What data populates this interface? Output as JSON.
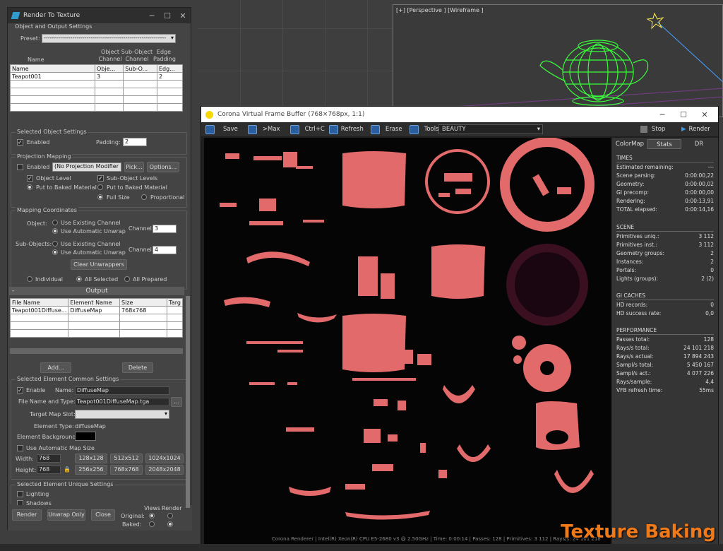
{
  "viewport": {
    "label": "[+] [Perspective ] [Wireframe ]"
  },
  "rtt": {
    "title": "Render To Texture",
    "section_object_output": "Object and Output Settings",
    "preset_label": "Preset:",
    "preset_value": "------------------------------------------------------------",
    "obj_headers_top": [
      "Name",
      "Object Channel",
      "Sub-Object Channel",
      "Edge Padding"
    ],
    "obj_cols": [
      "Name",
      "Obje...",
      "Sub-O...",
      "Edg..."
    ],
    "obj_rows": [
      [
        "Teapot001",
        "3",
        "",
        "2"
      ]
    ],
    "section_selected": "Selected Object Settings",
    "enabled_label": "Enabled",
    "padding_label": "Padding:",
    "padding_value": "2",
    "section_projection": "Projection Mapping",
    "proj_enabled": "Enabled",
    "proj_modifier": "(No Projection Modifier",
    "pick_btn": "Pick...",
    "options_btn": "Options...",
    "object_level": "Object Level",
    "sub_object_levels": "Sub-Object Levels",
    "put_to_baked": "Put to Baked Material",
    "put_to_baked2": "Put to Baked Material",
    "full_size": "Full Size",
    "proportional": "Proportional",
    "section_mapping": "Mapping Coordinates",
    "object_label": "Object:",
    "use_existing": "Use Existing Channel",
    "use_auto": "Use Automatic Unwrap",
    "channel_label": "Channel:",
    "channel_value": "3",
    "subobjects_label": "Sub-Objects:",
    "use_existing2": "Use Existing Channel",
    "use_auto2": "Use Automatic Unwrap",
    "channel_label2": "Channel:",
    "channel_value2": "4",
    "clear_unwrappers": "Clear Unwrappers",
    "individual": "Individual",
    "all_selected": "All Selected",
    "all_prepared": "All Prepared",
    "output_title": "Output",
    "out_cols": [
      "File Name",
      "Element Name",
      "Size",
      "Targ"
    ],
    "out_rows": [
      [
        "Teapot001Diffuse...",
        "DiffuseMap",
        "768x768",
        ""
      ]
    ],
    "add_btn": "Add...",
    "delete_btn": "Delete",
    "section_common": "Selected Element Common Settings",
    "enable_label": "Enable",
    "name_label": "Name:",
    "name_value": "DiffuseMap",
    "file_label": "File Name and Type:",
    "file_value": "Teapot001DiffuseMap.tga",
    "file_btn": "...",
    "target_slot": "Target Map Slot:",
    "element_type_label": "Element Type:",
    "element_type_value": "diffuseMap",
    "element_bg": "Element Background:",
    "use_auto_size": "Use Automatic Map Size",
    "width_label": "Width:",
    "width_value": "768",
    "height_label": "Height:",
    "height_value": "768",
    "sizes": [
      "128x128",
      "512x512",
      "1024x1024",
      "256x256",
      "768x768",
      "2048x2048"
    ],
    "section_unique": "Selected Element Unique Settings",
    "lighting": "Lighting",
    "shadows": "Shadows",
    "render_btn": "Render",
    "unwrap_btn": "Unwrap Only",
    "close_btn": "Close",
    "views_label": "Views",
    "render_label": "Render",
    "original_label": "Original:",
    "baked_label": "Baked:"
  },
  "vfb": {
    "title": "Corona Virtual Frame Buffer (768×768px, 1:1)",
    "toolbar": [
      "Save",
      ">Max",
      "Ctrl+C",
      "Refresh",
      "Erase",
      "Tools"
    ],
    "channel": "BEAUTY",
    "stop": "Stop",
    "render": "Render",
    "tabs": [
      "ColorMap",
      "Stats",
      "DR"
    ],
    "times_head": "TIMES",
    "times": [
      [
        "Estimated remaining:",
        "---"
      ],
      [
        "Scene parsing:",
        "0:00:00,22"
      ],
      [
        "Geometry:",
        "0:00:00,02"
      ],
      [
        "GI precomp:",
        "0:00:00,00"
      ],
      [
        "Rendering:",
        "0:00:13,91"
      ],
      [
        "TOTAL elapsed:",
        "0:00:14,16"
      ]
    ],
    "scene_head": "SCENE",
    "scene": [
      [
        "Primitives uniq.:",
        "3 112"
      ],
      [
        "Primitives inst.:",
        "3 112"
      ],
      [
        "Geometry groups:",
        "2"
      ],
      [
        "Instances:",
        "2"
      ],
      [
        "Portals:",
        "0"
      ],
      [
        "Lights (groups):",
        "2 (2)"
      ]
    ],
    "gi_head": "GI CACHES",
    "gi": [
      [
        "HD records:",
        "0"
      ],
      [
        "HD success rate:",
        "0,0"
      ]
    ],
    "perf_head": "PERFORMANCE",
    "perf": [
      [
        "Passes total:",
        "128"
      ],
      [
        "Rays/s total:",
        "24 101 218"
      ],
      [
        "Rays/s actual:",
        "17 894 243"
      ],
      [
        "Sampl/s total:",
        "5 450 167"
      ],
      [
        "Sampl/s act.:",
        "4 077 226"
      ],
      [
        "Rays/sample:",
        "4,4"
      ],
      [
        "VFB refresh time:",
        "55ms"
      ]
    ],
    "status": "Corona Renderer | Intel(R) Xeon(R) CPU E5-2680 v3 @ 2.50GHz | Time: 0:00:14 | Passes: 128 | Primitives: 3 112 | Rays/s: 24 101 218"
  },
  "watermark": "Texture Baking",
  "colors": {
    "uv": "#e36a6a",
    "accent": "#f07a1a",
    "wire": "#39ff3a"
  }
}
